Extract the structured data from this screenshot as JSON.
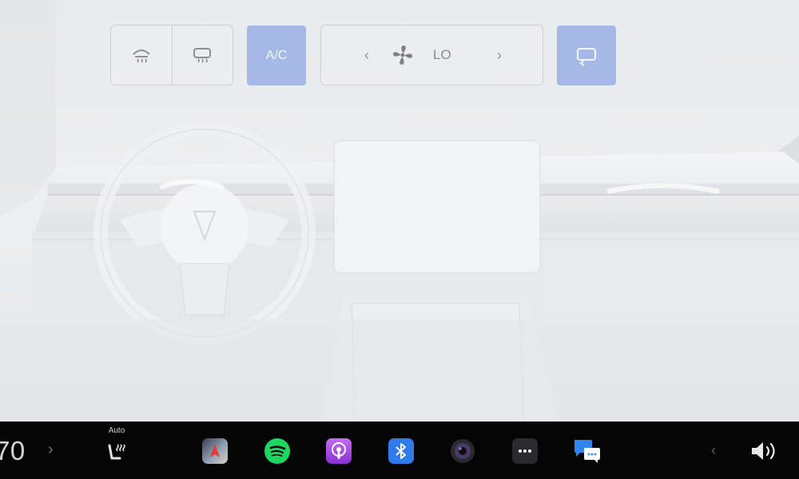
{
  "climate": {
    "front_defrost_icon": "front-defrost-icon",
    "rear_defrost_icon": "rear-defrost-icon",
    "ac_label": "A/C",
    "fan": {
      "decrease_label": "‹",
      "increase_label": "›",
      "level": "LO",
      "icon": "fan-icon"
    },
    "recirculate_icon": "recirculate-icon",
    "accent_color": "#a5b8e6"
  },
  "taskbar": {
    "temperature": "70",
    "temp_arrow": "›",
    "seat_heat_label": "Auto",
    "apps": [
      {
        "name": "navigation",
        "icon": "navigation-app-icon"
      },
      {
        "name": "spotify",
        "icon": "spotify-app-icon"
      },
      {
        "name": "podcasts",
        "icon": "podcasts-app-icon"
      },
      {
        "name": "bluetooth",
        "icon": "bluetooth-app-icon"
      },
      {
        "name": "camera",
        "icon": "camera-app-icon"
      },
      {
        "name": "more",
        "icon": "more-app-icon"
      },
      {
        "name": "messages",
        "icon": "messages-app-icon"
      }
    ],
    "nav_arrow": "‹",
    "volume_icon": "volume-icon"
  }
}
